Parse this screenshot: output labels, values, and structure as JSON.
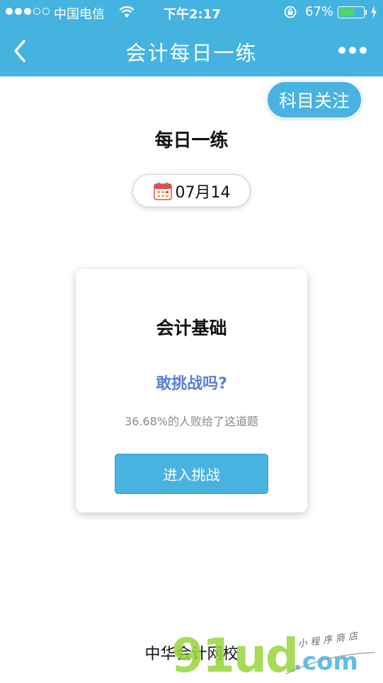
{
  "status_bar": {
    "carrier": "中国电信",
    "time": "下午2:17",
    "battery_percent": "67%",
    "battery_level": 0.67,
    "signal_bars_on": 3,
    "signal_bars_total": 5
  },
  "nav": {
    "title": "会计每日一练",
    "back_icon": "chevron-left-icon",
    "more_icon": "more-dots-icon"
  },
  "follow_button": {
    "label": "科目关注"
  },
  "page": {
    "title": "每日一练",
    "date": "07月14",
    "date_icon": "calendar-icon"
  },
  "card": {
    "subject": "会计基础",
    "question": "敢挑战吗?",
    "fail_rate_text": "36.68%的人败给了这道题",
    "enter_button": "进入挑战"
  },
  "footer": {
    "brand": "中华会计网校"
  },
  "watermark": {
    "word": "91ud",
    "tld": ".com",
    "tagline": "小程序商店"
  },
  "colors": {
    "primary": "#45b3e0",
    "question_text": "#5b7fd6",
    "muted_text": "#8a8a8a",
    "battery_fill": "#4cd964",
    "watermark_green": "#97d53a"
  }
}
